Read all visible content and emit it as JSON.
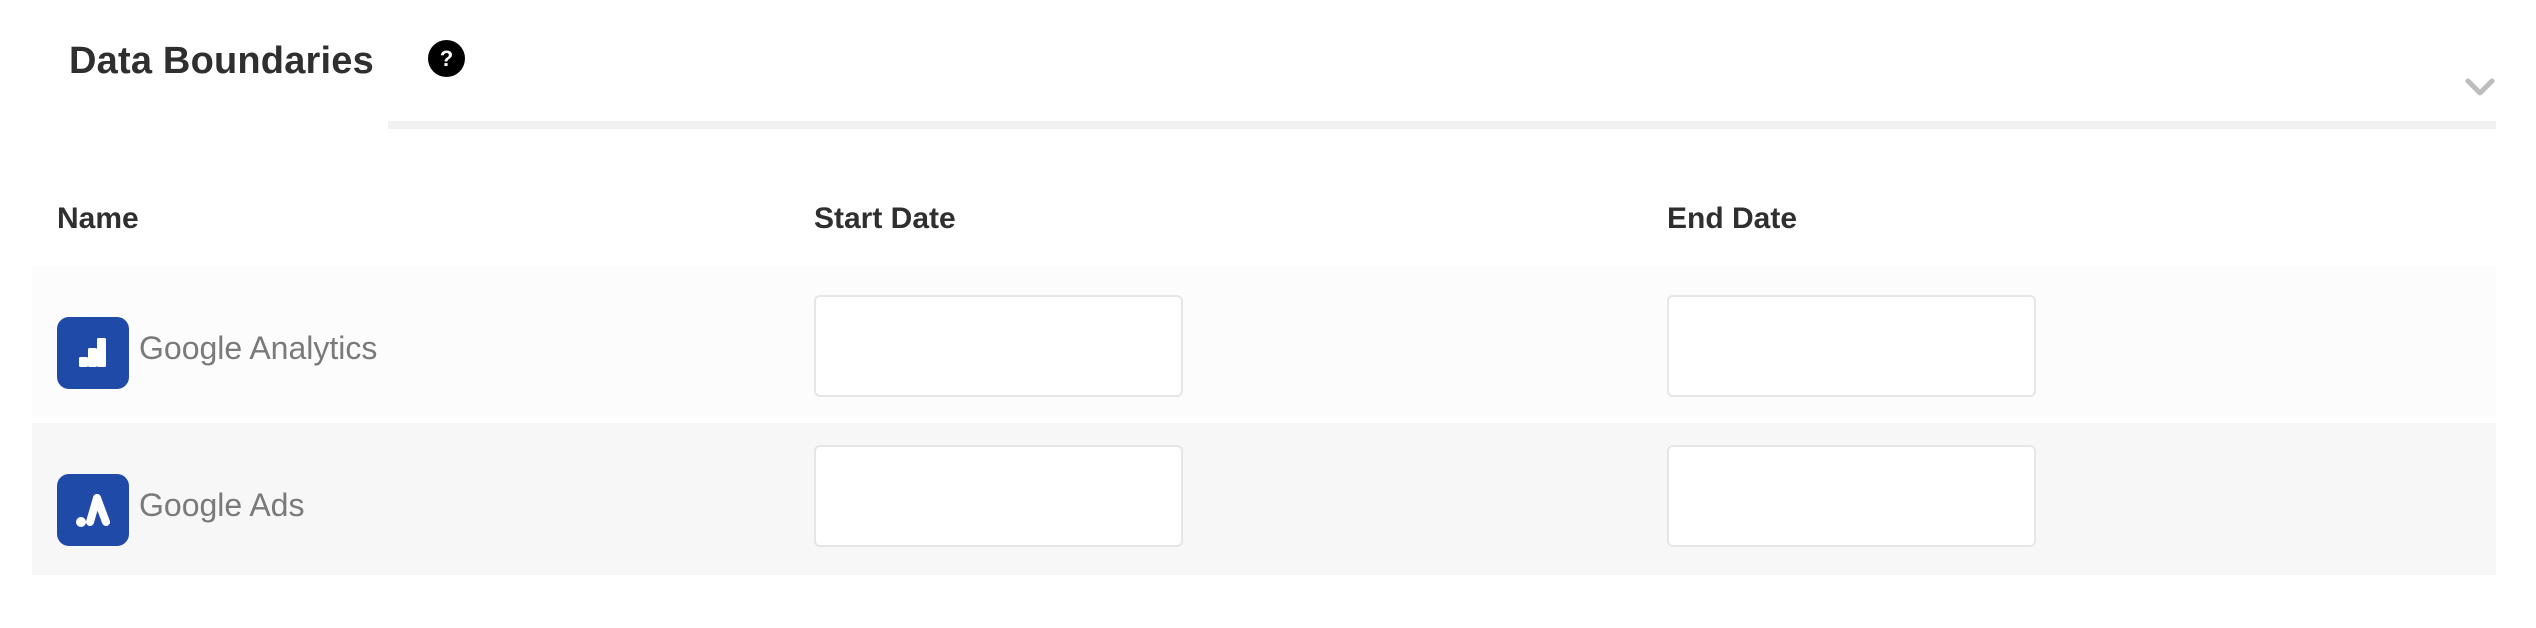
{
  "header": {
    "title": "Data Boundaries",
    "help_label": "?",
    "help_icon": "question-circle-icon",
    "collapse_icon": "chevron-down-icon"
  },
  "table": {
    "columns": [
      "Name",
      "Start Date",
      "End Date"
    ],
    "rows": [
      {
        "name": "Google Analytics",
        "icon": "google-analytics-icon",
        "start_date": "",
        "end_date": ""
      },
      {
        "name": "Google Ads",
        "icon": "google-ads-icon",
        "start_date": "",
        "end_date": ""
      }
    ]
  },
  "colors": {
    "logo_background": "#1f4aa8",
    "help_background": "#000000",
    "row_alt_background": "#f7f7f7"
  }
}
